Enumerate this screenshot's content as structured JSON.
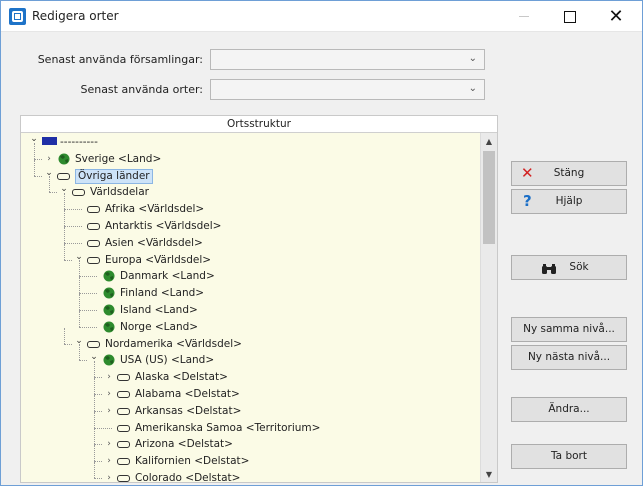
{
  "window": {
    "title": "Redigera orter"
  },
  "combos": [
    {
      "label": "Senast använda församlingar:",
      "value": ""
    },
    {
      "label": "Senast använda orter:",
      "value": ""
    }
  ],
  "tree": {
    "header": "Ortsstruktur",
    "rows": [
      {
        "depth": 0,
        "expander": "open",
        "icon": "flag-icon",
        "text": "----------"
      },
      {
        "depth": 1,
        "expander": "closed",
        "icon": "globe-icon",
        "text": "Sverige <Land>"
      },
      {
        "depth": 1,
        "expander": "open",
        "icon": "folder-icon",
        "text": "Övriga länder",
        "selected": true
      },
      {
        "depth": 2,
        "expander": "open",
        "icon": "folder-icon",
        "text": "Världsdelar"
      },
      {
        "depth": 3,
        "expander": "none",
        "icon": "folder-icon",
        "text": "Afrika <Världsdel>"
      },
      {
        "depth": 3,
        "expander": "none",
        "icon": "folder-icon",
        "text": "Antarktis <Världsdel>"
      },
      {
        "depth": 3,
        "expander": "none",
        "icon": "folder-icon",
        "text": "Asien <Världsdel>"
      },
      {
        "depth": 3,
        "expander": "open",
        "icon": "folder-icon",
        "text": "Europa <Världsdel>"
      },
      {
        "depth": 4,
        "expander": "none",
        "icon": "globe-icon",
        "text": "Danmark <Land>"
      },
      {
        "depth": 4,
        "expander": "none",
        "icon": "globe-icon",
        "text": "Finland <Land>"
      },
      {
        "depth": 4,
        "expander": "none",
        "icon": "globe-icon",
        "text": "Island <Land>"
      },
      {
        "depth": 4,
        "expander": "none",
        "icon": "globe-icon",
        "text": "Norge <Land>"
      },
      {
        "depth": 3,
        "expander": "open",
        "icon": "folder-icon",
        "text": "Nordamerika <Världsdel>"
      },
      {
        "depth": 4,
        "expander": "open",
        "icon": "globe-icon",
        "text": "USA (US) <Land>"
      },
      {
        "depth": 5,
        "expander": "closed",
        "icon": "folder-icon",
        "text": "Alaska <Delstat>"
      },
      {
        "depth": 5,
        "expander": "closed",
        "icon": "folder-icon",
        "text": "Alabama <Delstat>"
      },
      {
        "depth": 5,
        "expander": "closed",
        "icon": "folder-icon",
        "text": "Arkansas <Delstat>"
      },
      {
        "depth": 5,
        "expander": "none",
        "icon": "folder-icon",
        "text": "Amerikanska Samoa <Territorium>"
      },
      {
        "depth": 5,
        "expander": "closed",
        "icon": "folder-icon",
        "text": "Arizona <Delstat>"
      },
      {
        "depth": 5,
        "expander": "closed",
        "icon": "folder-icon",
        "text": "Kalifornien <Delstat>"
      },
      {
        "depth": 5,
        "expander": "closed",
        "icon": "folder-icon",
        "text": "Colorado <Delstat>"
      }
    ]
  },
  "buttons": {
    "close": "Stäng",
    "help": "Hjälp",
    "search": "Sök",
    "new_same": "Ny samma nivå...",
    "new_next": "Ny nästa nivå...",
    "edit": "Ändra...",
    "delete": "Ta bort"
  },
  "colors": {
    "tree_bg": "#fbfbe6",
    "selection": "#cde3f8",
    "globe": "#2e8b2e",
    "close_x": "#d22222",
    "help_q": "#1b6fc7"
  }
}
